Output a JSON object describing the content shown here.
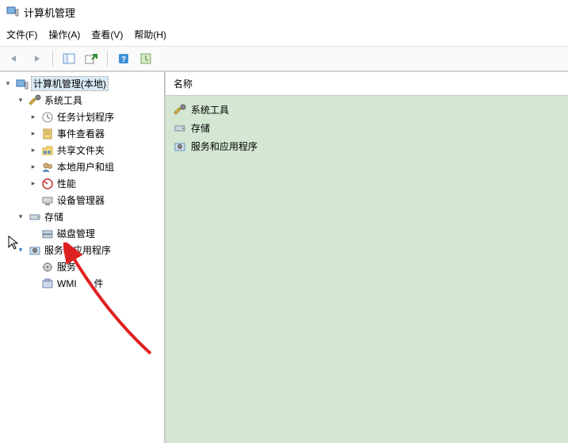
{
  "window": {
    "title": "计算机管理"
  },
  "menu": {
    "file": "文件(F)",
    "action": "操作(A)",
    "view": "查看(V)",
    "help": "帮助(H)"
  },
  "toolbar_icons": {
    "back": "back-icon",
    "forward": "forward-icon",
    "up": "up-icon",
    "showhide": "showhide-icon",
    "export": "export-icon",
    "help": "help-icon",
    "props": "props-icon"
  },
  "right": {
    "header": "名称",
    "items": [
      {
        "icon": "tools-icon",
        "label": "系统工具"
      },
      {
        "icon": "storage-icon",
        "label": "存储"
      },
      {
        "icon": "services-apps-icon",
        "label": "服务和应用程序"
      }
    ]
  },
  "tree": {
    "root": {
      "label": "计算机管理(本地)",
      "icon": "computer-icon",
      "expanded": true
    },
    "system_tools": {
      "label": "系统工具",
      "icon": "tools-icon",
      "expanded": true,
      "children": [
        {
          "label": "任务计划程序",
          "icon": "task-scheduler-icon"
        },
        {
          "label": "事件查看器",
          "icon": "event-viewer-icon"
        },
        {
          "label": "共享文件夹",
          "icon": "shared-folders-icon"
        },
        {
          "label": "本地用户和组",
          "icon": "local-users-groups-icon"
        },
        {
          "label": "性能",
          "icon": "performance-icon"
        },
        {
          "label": "设备管理器",
          "icon": "device-manager-icon"
        }
      ]
    },
    "storage": {
      "label": "存储",
      "icon": "storage-icon",
      "expanded": true,
      "children": [
        {
          "label": "磁盘管理",
          "icon": "disk-management-icon"
        }
      ]
    },
    "services_apps": {
      "label": "服务和应用程序",
      "icon": "services-apps-icon",
      "expanded": true,
      "children": [
        {
          "label": "服务",
          "icon": "services-icon"
        },
        {
          "label": "WMI",
          "icon": "wmi-icon",
          "suffix": "件"
        }
      ]
    }
  }
}
